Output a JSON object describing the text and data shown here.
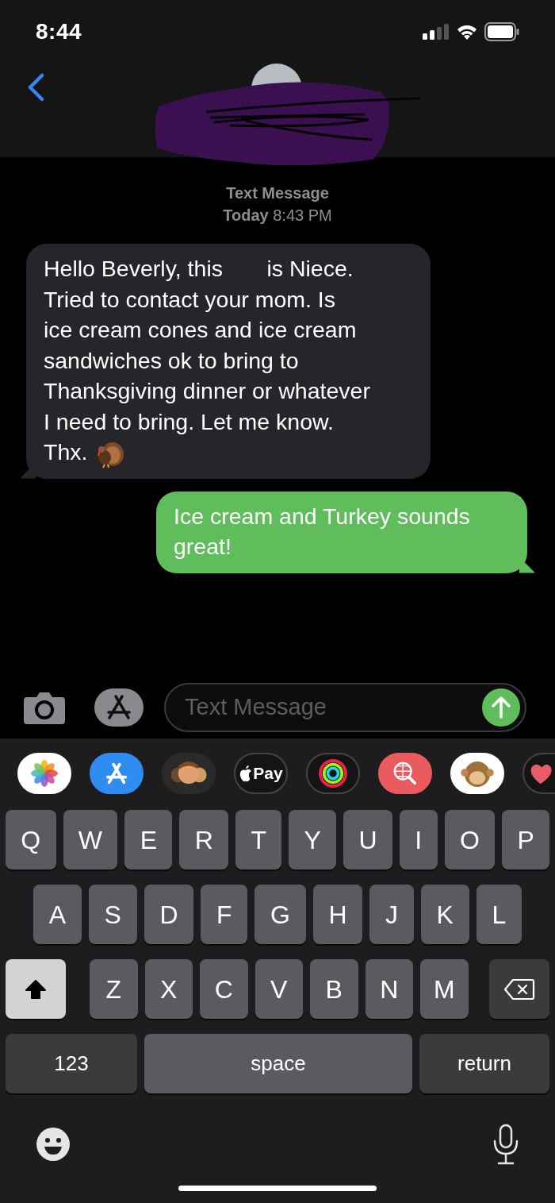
{
  "status_bar": {
    "time": "8:44"
  },
  "thread": {
    "service": "Text Message",
    "timestamp": "**Today** 8:43 PM"
  },
  "messages": [
    {
      "kind": "received",
      "text": "Hello Beverly, this       is Niece.\nTried to contact your mom. Is\nice cream cones and ice cream\nsandwiches ok to bring to\nThanksgiving dinner or whatever\nI need to bring. Let me know.\nThx.",
      "turkey": true
    },
    {
      "kind": "sent",
      "text": "Ice cream and Turkey sounds\ngreat!",
      "turkey": false
    }
  ],
  "compose": {
    "placeholder": "Text Message"
  },
  "app_strip": [
    {
      "kind": "photos"
    },
    {
      "kind": "appstore"
    },
    {
      "kind": "memoji"
    },
    {
      "kind": "pay",
      "label": "Pay"
    },
    {
      "kind": "activity"
    },
    {
      "kind": "search"
    },
    {
      "kind": "animal"
    },
    {
      "kind": "heart"
    }
  ],
  "keyboard": {
    "rows": [
      [
        "Q",
        "W",
        "E",
        "R",
        "T",
        "Y",
        "U",
        "I",
        "O",
        "P"
      ],
      [
        "A",
        "S",
        "D",
        "F",
        "G",
        "H",
        "J",
        "K",
        "L"
      ],
      [
        "Z",
        "X",
        "C",
        "V",
        "B",
        "N",
        "M"
      ]
    ],
    "shift": {
      "on": true
    },
    "numbers_key": "123",
    "space_key": "space",
    "return_key": "return"
  }
}
